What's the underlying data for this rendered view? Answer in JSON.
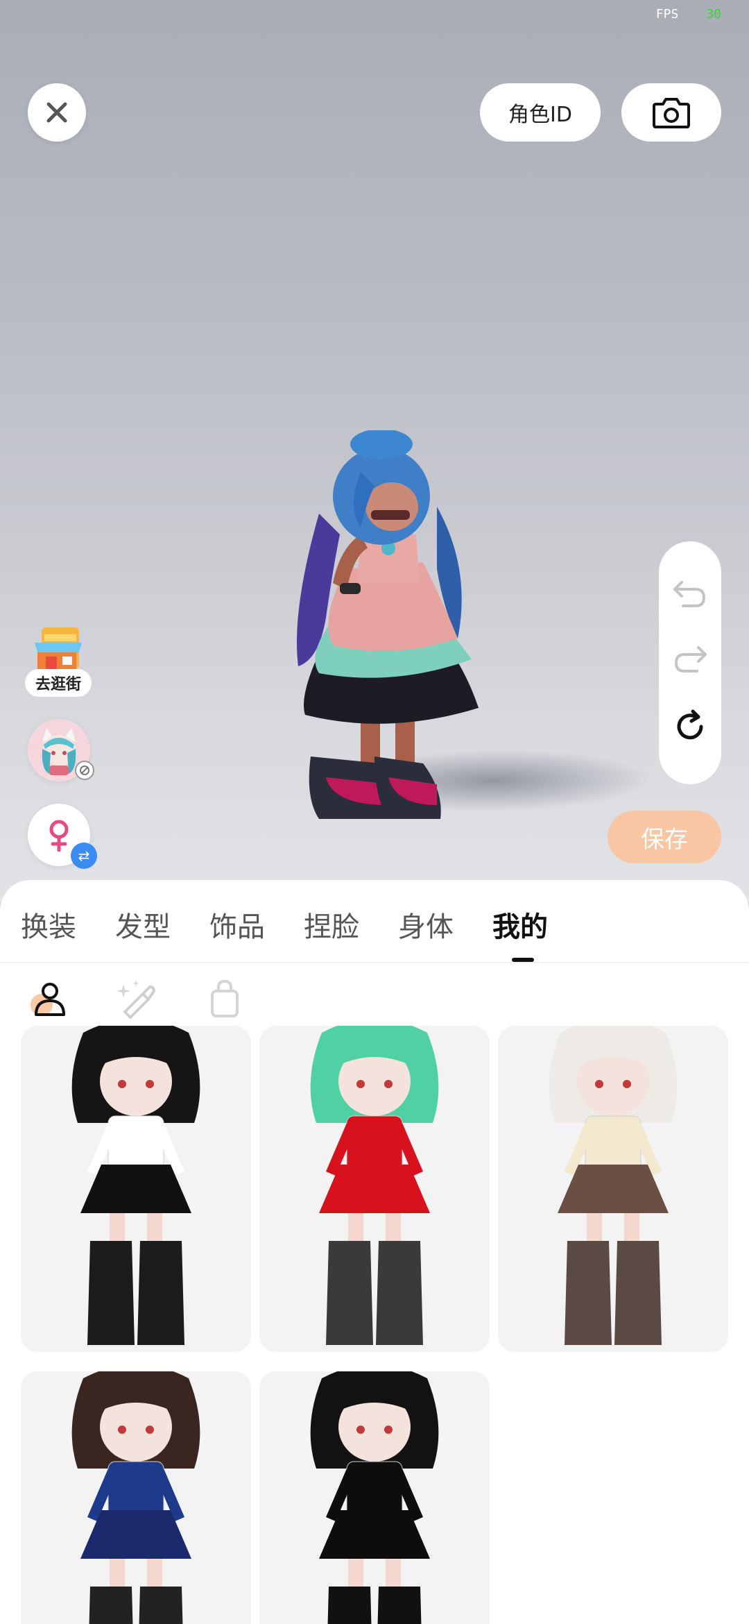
{
  "status": {
    "fps_label": "FPS",
    "fps_value": "30"
  },
  "header": {
    "role_id_label": "角色ID"
  },
  "side": {
    "shop_label": "去逛街",
    "save_label": "保存"
  },
  "tabs": [
    {
      "label": "换装"
    },
    {
      "label": "发型"
    },
    {
      "label": "饰品"
    },
    {
      "label": "捏脸"
    },
    {
      "label": "身体"
    },
    {
      "label": "我的",
      "active": true
    }
  ],
  "subtabs": [
    {
      "icon": "person-icon",
      "active": true
    },
    {
      "icon": "magic-brush-icon",
      "active": false
    },
    {
      "icon": "bag-icon",
      "active": false
    }
  ],
  "outfits": [
    {
      "name": "black-maid-outfit",
      "hair": "#151515",
      "top": "#ffffff",
      "skirt": "#111111",
      "boots": "#1c1c1c"
    },
    {
      "name": "red-dress-outfit",
      "hair": "#4fd1a3",
      "top": "#d8121c",
      "skirt": "#d8121c",
      "boots": "#3a3a3a"
    },
    {
      "name": "sponge-costume-outfit",
      "hair": "#eeeae6",
      "top": "#f3e9cf",
      "skirt": "#6b4f45",
      "boots": "#5b4a44"
    },
    {
      "name": "blue-coat-outfit",
      "hair": "#3a2521",
      "top": "#1e3a8a",
      "skirt": "#1a2a6c",
      "boots": "#222222"
    },
    {
      "name": "black-hoodie-outfit",
      "hair": "#121212",
      "top": "#0d0d0d",
      "skirt": "#0d0d0d",
      "boots": "#111111"
    }
  ],
  "colors": {
    "accent": "#f9c6a4",
    "swap_badge": "#3a8cf3",
    "fps_value": "#3ad13a"
  }
}
